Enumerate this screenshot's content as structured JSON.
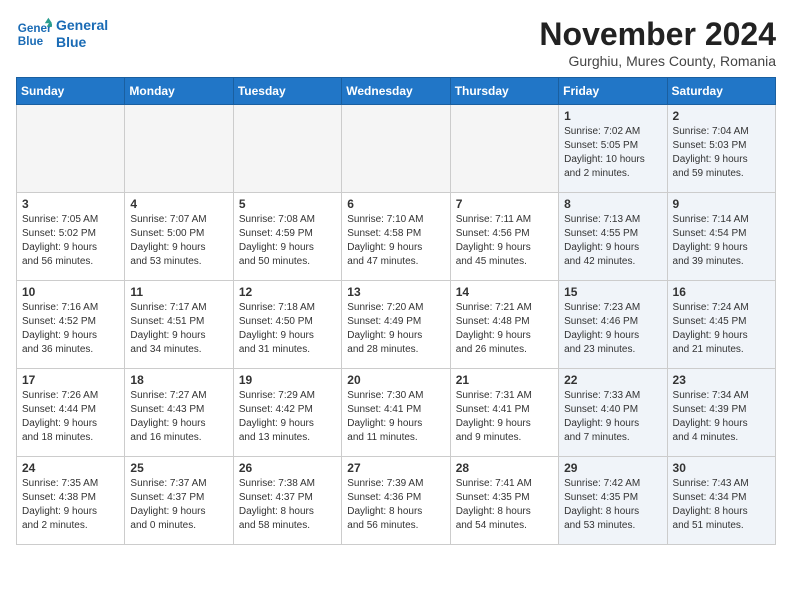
{
  "logo": {
    "line1": "General",
    "line2": "Blue"
  },
  "title": "November 2024",
  "subtitle": "Gurghiu, Mures County, Romania",
  "headers": [
    "Sunday",
    "Monday",
    "Tuesday",
    "Wednesday",
    "Thursday",
    "Friday",
    "Saturday"
  ],
  "weeks": [
    [
      {
        "day": "",
        "info": "",
        "empty": true
      },
      {
        "day": "",
        "info": "",
        "empty": true
      },
      {
        "day": "",
        "info": "",
        "empty": true
      },
      {
        "day": "",
        "info": "",
        "empty": true
      },
      {
        "day": "",
        "info": "",
        "empty": true
      },
      {
        "day": "1",
        "info": "Sunrise: 7:02 AM\nSunset: 5:05 PM\nDaylight: 10 hours\nand 2 minutes.",
        "shaded": true
      },
      {
        "day": "2",
        "info": "Sunrise: 7:04 AM\nSunset: 5:03 PM\nDaylight: 9 hours\nand 59 minutes.",
        "shaded": true
      }
    ],
    [
      {
        "day": "3",
        "info": "Sunrise: 7:05 AM\nSunset: 5:02 PM\nDaylight: 9 hours\nand 56 minutes."
      },
      {
        "day": "4",
        "info": "Sunrise: 7:07 AM\nSunset: 5:00 PM\nDaylight: 9 hours\nand 53 minutes."
      },
      {
        "day": "5",
        "info": "Sunrise: 7:08 AM\nSunset: 4:59 PM\nDaylight: 9 hours\nand 50 minutes."
      },
      {
        "day": "6",
        "info": "Sunrise: 7:10 AM\nSunset: 4:58 PM\nDaylight: 9 hours\nand 47 minutes."
      },
      {
        "day": "7",
        "info": "Sunrise: 7:11 AM\nSunset: 4:56 PM\nDaylight: 9 hours\nand 45 minutes."
      },
      {
        "day": "8",
        "info": "Sunrise: 7:13 AM\nSunset: 4:55 PM\nDaylight: 9 hours\nand 42 minutes.",
        "shaded": true
      },
      {
        "day": "9",
        "info": "Sunrise: 7:14 AM\nSunset: 4:54 PM\nDaylight: 9 hours\nand 39 minutes.",
        "shaded": true
      }
    ],
    [
      {
        "day": "10",
        "info": "Sunrise: 7:16 AM\nSunset: 4:52 PM\nDaylight: 9 hours\nand 36 minutes."
      },
      {
        "day": "11",
        "info": "Sunrise: 7:17 AM\nSunset: 4:51 PM\nDaylight: 9 hours\nand 34 minutes."
      },
      {
        "day": "12",
        "info": "Sunrise: 7:18 AM\nSunset: 4:50 PM\nDaylight: 9 hours\nand 31 minutes."
      },
      {
        "day": "13",
        "info": "Sunrise: 7:20 AM\nSunset: 4:49 PM\nDaylight: 9 hours\nand 28 minutes."
      },
      {
        "day": "14",
        "info": "Sunrise: 7:21 AM\nSunset: 4:48 PM\nDaylight: 9 hours\nand 26 minutes."
      },
      {
        "day": "15",
        "info": "Sunrise: 7:23 AM\nSunset: 4:46 PM\nDaylight: 9 hours\nand 23 minutes.",
        "shaded": true
      },
      {
        "day": "16",
        "info": "Sunrise: 7:24 AM\nSunset: 4:45 PM\nDaylight: 9 hours\nand 21 minutes.",
        "shaded": true
      }
    ],
    [
      {
        "day": "17",
        "info": "Sunrise: 7:26 AM\nSunset: 4:44 PM\nDaylight: 9 hours\nand 18 minutes."
      },
      {
        "day": "18",
        "info": "Sunrise: 7:27 AM\nSunset: 4:43 PM\nDaylight: 9 hours\nand 16 minutes."
      },
      {
        "day": "19",
        "info": "Sunrise: 7:29 AM\nSunset: 4:42 PM\nDaylight: 9 hours\nand 13 minutes."
      },
      {
        "day": "20",
        "info": "Sunrise: 7:30 AM\nSunset: 4:41 PM\nDaylight: 9 hours\nand 11 minutes."
      },
      {
        "day": "21",
        "info": "Sunrise: 7:31 AM\nSunset: 4:41 PM\nDaylight: 9 hours\nand 9 minutes."
      },
      {
        "day": "22",
        "info": "Sunrise: 7:33 AM\nSunset: 4:40 PM\nDaylight: 9 hours\nand 7 minutes.",
        "shaded": true
      },
      {
        "day": "23",
        "info": "Sunrise: 7:34 AM\nSunset: 4:39 PM\nDaylight: 9 hours\nand 4 minutes.",
        "shaded": true
      }
    ],
    [
      {
        "day": "24",
        "info": "Sunrise: 7:35 AM\nSunset: 4:38 PM\nDaylight: 9 hours\nand 2 minutes."
      },
      {
        "day": "25",
        "info": "Sunrise: 7:37 AM\nSunset: 4:37 PM\nDaylight: 9 hours\nand 0 minutes."
      },
      {
        "day": "26",
        "info": "Sunrise: 7:38 AM\nSunset: 4:37 PM\nDaylight: 8 hours\nand 58 minutes."
      },
      {
        "day": "27",
        "info": "Sunrise: 7:39 AM\nSunset: 4:36 PM\nDaylight: 8 hours\nand 56 minutes."
      },
      {
        "day": "28",
        "info": "Sunrise: 7:41 AM\nSunset: 4:35 PM\nDaylight: 8 hours\nand 54 minutes."
      },
      {
        "day": "29",
        "info": "Sunrise: 7:42 AM\nSunset: 4:35 PM\nDaylight: 8 hours\nand 53 minutes.",
        "shaded": true
      },
      {
        "day": "30",
        "info": "Sunrise: 7:43 AM\nSunset: 4:34 PM\nDaylight: 8 hours\nand 51 minutes.",
        "shaded": true
      }
    ]
  ]
}
